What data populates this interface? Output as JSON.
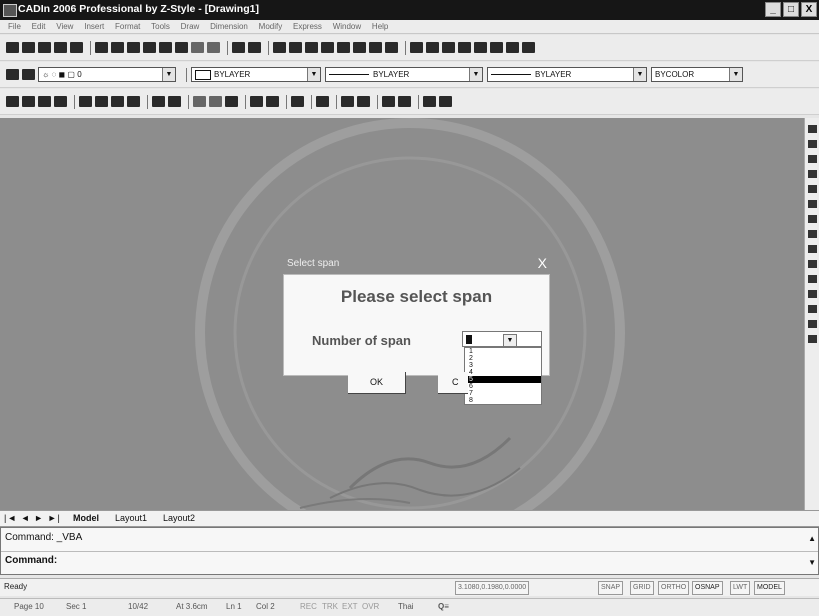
{
  "window": {
    "title": "CADIn 2006 Professional by Z-Style - [Drawing1]",
    "min": "_",
    "restore": "□",
    "close": "X"
  },
  "menu": [
    "File",
    "Edit",
    "View",
    "Insert",
    "Format",
    "Tools",
    "Draw",
    "Dimension",
    "Modify",
    "Express",
    "Window",
    "Help"
  ],
  "toolbar2": {
    "layer": "0",
    "color": "BYLAYER",
    "linetype": "BYLAYER",
    "lineweight": "BYLAYER",
    "plotstyle": "BYCOLOR"
  },
  "dialog": {
    "title": "Select span",
    "close": "X",
    "heading": "Please select span",
    "label": "Number of span",
    "selected": "1",
    "options": [
      "1",
      "2",
      "3",
      "4",
      "5",
      "6",
      "7",
      "8"
    ],
    "highlighted_index": 4,
    "ok": "OK",
    "cancel": "C"
  },
  "tabs": {
    "nav": "|◄ ◄ ► ►|",
    "model": "Model",
    "layout1": "Layout1",
    "layout2": "Layout2"
  },
  "command": {
    "line1": "Command: _VBA",
    "line2": "Command:"
  },
  "status": {
    "ready": "Ready",
    "coords": "3.1080,0.1980,0.0000",
    "toggles": [
      "SNAP",
      "GRID",
      "ORTHO",
      "OSNAP",
      "LWT",
      "MODEL"
    ]
  },
  "wordbar": [
    "Page 10",
    "Sec 1",
    "10/42",
    "At 3.6cm",
    "Ln 1",
    "Col 2",
    "REC",
    "TRK",
    "EXT",
    "OVR",
    "Thai"
  ]
}
